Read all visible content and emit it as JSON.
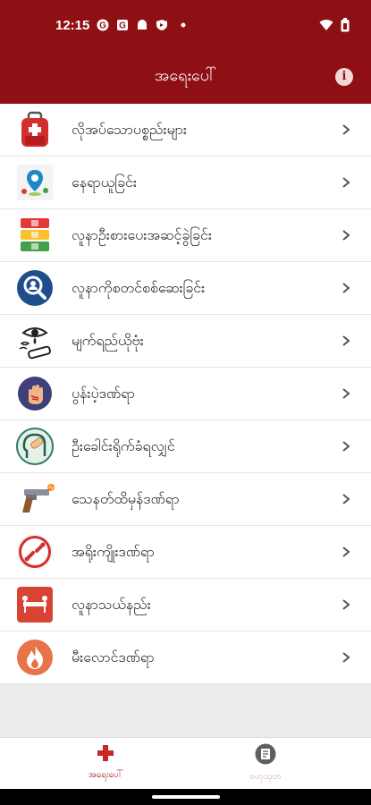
{
  "status": {
    "time": "12:15",
    "icons": [
      "google-icon",
      "mail-icon",
      "android-icon",
      "shield-icon",
      "dot-icon"
    ],
    "right_icons": [
      "wifi-icon",
      "battery-icon"
    ]
  },
  "header": {
    "title": "အရေးပေါ်",
    "info_icon": "info-icon",
    "info_glyph": "i"
  },
  "items": [
    {
      "label": "လိုအပ်သောပစ္စည်းများ",
      "icon": "first-aid-bag-icon"
    },
    {
      "label": "နေရာယူခြင်း",
      "icon": "map-pin-icon"
    },
    {
      "label": "လူနာဦးစားပေးအဆင့်ခွဲခြင်း",
      "icon": "triage-levels-icon"
    },
    {
      "label": "လူနာကိုစတင်စစ်ဆေးခြင်း",
      "icon": "search-person-icon"
    },
    {
      "label": "မျက်ရည်ယိုဗုံး",
      "icon": "tear-gas-icon"
    },
    {
      "label": "ပွန်းပဲ့ဒဏ်ရာ",
      "icon": "abrasion-hand-icon"
    },
    {
      "label": "ဦးခေါင်းရိုက်ခံရလျှင်",
      "icon": "head-injury-icon"
    },
    {
      "label": "သေနတ်ထိမှန်ဒဏ်ရာ",
      "icon": "gun-icon"
    },
    {
      "label": "အရိုးကျိုးဒဏ်ရာ",
      "icon": "broken-bone-icon"
    },
    {
      "label": "လူနာသယ်နည်း",
      "icon": "stretcher-icon"
    },
    {
      "label": "မီးလောင်ဒဏ်ရာ",
      "icon": "fire-icon"
    }
  ],
  "nav": {
    "home": {
      "label": "အရေးပေါ်",
      "icon": "medical-cross-icon"
    },
    "knowledge": {
      "label": "ဗဟုသုတ",
      "icon": "book-icon"
    }
  },
  "colors": {
    "brand": "#8e0f14",
    "accent_red": "#d32f2f",
    "nav_active": "#a01418"
  }
}
